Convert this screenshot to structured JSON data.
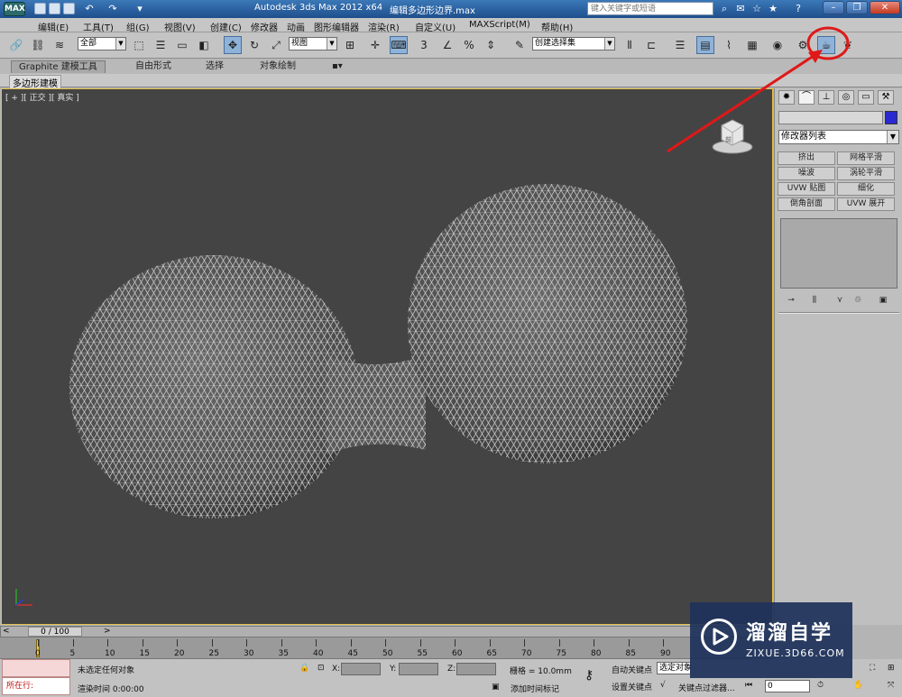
{
  "window": {
    "title": "Autodesk 3ds Max  2012 x64",
    "file": "编辑多边形边界.max",
    "help_search_placeholder": "键入关键字或短语",
    "app_icon_label": "MAX"
  },
  "menu": {
    "items": [
      "编辑(E)",
      "工具(T)",
      "组(G)",
      "视图(V)",
      "创建(C)",
      "修改器",
      "动画",
      "图形编辑器",
      "渲染(R)",
      "自定义(U)",
      "MAXScript(M)",
      "帮助(H)"
    ]
  },
  "toolbar": {
    "selection_filter": "全部",
    "reference_coord": "视图",
    "named_selection": "创建选择集",
    "snap_value_label": "3",
    "percent_label": "%"
  },
  "ribbon": {
    "tabs": [
      "Graphite 建模工具",
      "自由形式",
      "选择",
      "对象绘制"
    ],
    "sub_label": "多边形建模"
  },
  "viewport": {
    "label": "[ + ][ 正交 ][ 真实 ]",
    "cube_label": "前"
  },
  "command_panel": {
    "modifier_list": "修改器列表",
    "buttons": [
      "挤出",
      "网格平滑",
      "噪波",
      "涡轮平滑",
      "UVW 贴图",
      "细化",
      "倒角剖面",
      "UVW 展开"
    ],
    "object_color": "#2a2ad0"
  },
  "timeline": {
    "frame_label": "0 / 100",
    "ticks": [
      "0",
      "5",
      "10",
      "15",
      "20",
      "25",
      "30",
      "35",
      "40",
      "45",
      "50",
      "55",
      "60",
      "65",
      "70",
      "75",
      "80",
      "85",
      "90"
    ]
  },
  "status": {
    "script_label": "所在行:",
    "selection_text": "未选定任何对象",
    "render_time": "渲染时间 0:00:00",
    "x_label": "X:",
    "y_label": "Y:",
    "z_label": "Z:",
    "grid": "栅格 = 10.0mm",
    "add_time_tag": "添加时间标记",
    "auto_key": "自动关键点",
    "selected_objects": "选定对象",
    "set_key": "设置关键点",
    "key_filters": "关键点过滤器...",
    "current_frame": "0"
  },
  "watermark": {
    "title": "溜溜自学",
    "subtitle": "ZIXUE.3D66.COM"
  },
  "colors": {
    "annotation_red": "#e01818",
    "viewport_bg": "#444444",
    "active_viewport_border": "#e2c14a"
  }
}
